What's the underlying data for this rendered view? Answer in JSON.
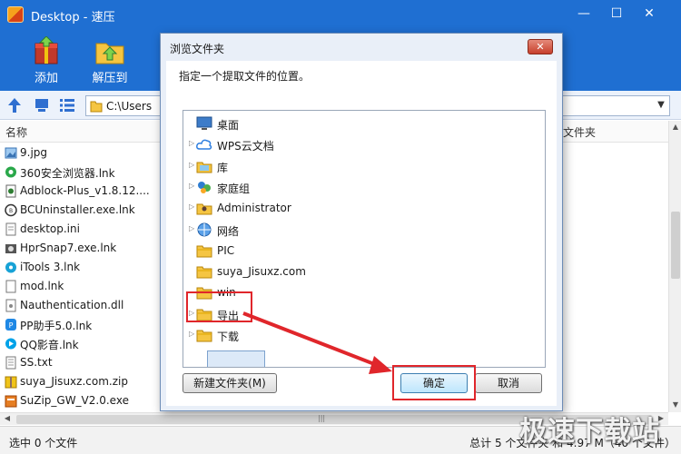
{
  "window": {
    "title": "Desktop - 速压"
  },
  "window_controls": {
    "minimize": "—",
    "maximize": "☐",
    "close": "✕"
  },
  "toolbar": {
    "add_label": "添加",
    "extract_label": "解压到"
  },
  "navbar": {
    "path": "C:\\Users"
  },
  "columns": {
    "name": "名称",
    "type": "文件夹"
  },
  "files": [
    {
      "name": "9.jpg",
      "icon": "image-icon"
    },
    {
      "name": "360安全浏览器.lnk",
      "icon": "browser-360-icon"
    },
    {
      "name": "Adblock-Plus_v1.8.12....",
      "icon": "adblock-icon"
    },
    {
      "name": "BCUninstaller.exe.lnk",
      "icon": "bc-icon"
    },
    {
      "name": "desktop.ini",
      "icon": "ini-file-icon"
    },
    {
      "name": "HprSnap7.exe.lnk",
      "icon": "hypersnap-icon"
    },
    {
      "name": "iTools 3.lnk",
      "icon": "itools-icon"
    },
    {
      "name": "mod.lnk",
      "icon": "shortcut-icon"
    },
    {
      "name": "Nauthentication.dll",
      "icon": "dll-file-icon"
    },
    {
      "name": "PP助手5.0.lnk",
      "icon": "pp-icon"
    },
    {
      "name": "QQ影音.lnk",
      "icon": "qq-player-icon"
    },
    {
      "name": "SS.txt",
      "icon": "txt-file-icon"
    },
    {
      "name": "suya_Jisuxz.com.zip",
      "icon": "zip-file-icon"
    },
    {
      "name": "SuZip_GW_V2.0.exe",
      "icon": "exe-file-icon"
    }
  ],
  "status": {
    "left": "选中 0 个文件",
    "right": "总计 5 个文件夹 和 4.97 M（40 个文件）"
  },
  "watermark": "极速下载站",
  "dialog": {
    "title": "浏览文件夹",
    "close_label": "✕",
    "prompt": "指定一个提取文件的位置。",
    "tree": [
      {
        "label": "桌面",
        "icon": "desktop-icon",
        "expandable": false
      },
      {
        "label": "WPS云文档",
        "icon": "cloud-icon",
        "expandable": true
      },
      {
        "label": "库",
        "icon": "library-icon",
        "expandable": true
      },
      {
        "label": "家庭组",
        "icon": "homegroup-icon",
        "expandable": true
      },
      {
        "label": "Administrator",
        "icon": "user-folder-icon",
        "expandable": true
      },
      {
        "label": "网络",
        "icon": "network-icon",
        "expandable": true
      },
      {
        "label": "PIC",
        "icon": "folder-icon",
        "expandable": false
      },
      {
        "label": "suya_Jisuxz.com",
        "icon": "folder-icon",
        "expandable": false
      },
      {
        "label": "win",
        "icon": "folder-icon",
        "expandable": false
      },
      {
        "label": "导出",
        "icon": "folder-icon",
        "expandable": true,
        "selected": true
      },
      {
        "label": "下载",
        "icon": "folder-icon",
        "expandable": true
      }
    ],
    "new_folder_label": "新建文件夹(M)",
    "ok_label": "确定",
    "cancel_label": "取消"
  },
  "colors": {
    "titlebar": "#1f6fd2",
    "highlight": "#e0262b"
  }
}
